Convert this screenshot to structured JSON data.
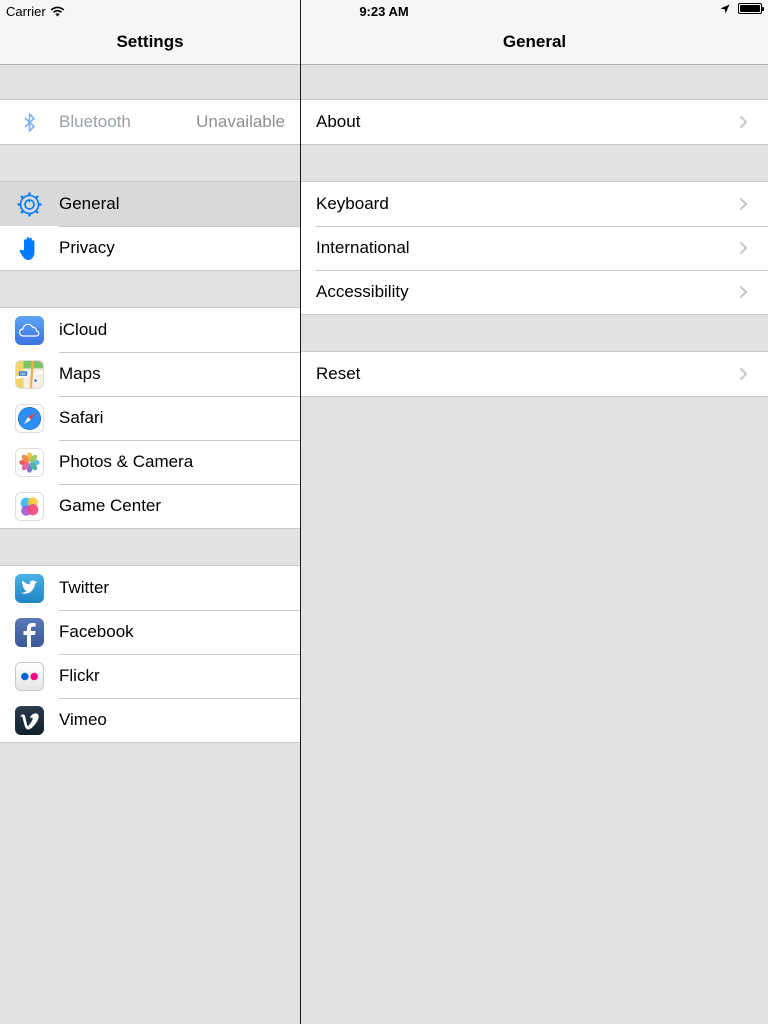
{
  "status_bar": {
    "carrier": "Carrier",
    "time": "9:23 AM"
  },
  "master": {
    "title": "Settings",
    "groups": [
      [
        {
          "icon": "bluetooth-icon",
          "label": "Bluetooth",
          "value": "Unavailable"
        }
      ],
      [
        {
          "icon": "gear-icon",
          "label": "General",
          "selected": true
        },
        {
          "icon": "hand-icon",
          "label": "Privacy"
        }
      ],
      [
        {
          "icon": "icloud-icon",
          "label": "iCloud"
        },
        {
          "icon": "maps-icon",
          "label": "Maps"
        },
        {
          "icon": "safari-compass-icon",
          "label": "Safari"
        },
        {
          "icon": "photos-flower-icon",
          "label": "Photos & Camera"
        },
        {
          "icon": "game-center-icon",
          "label": "Game Center"
        }
      ],
      [
        {
          "icon": "twitter-bird-icon",
          "label": "Twitter"
        },
        {
          "icon": "facebook-icon",
          "label": "Facebook"
        },
        {
          "icon": "flickr-icon",
          "label": "Flickr"
        },
        {
          "icon": "vimeo-icon",
          "label": "Vimeo"
        }
      ]
    ]
  },
  "detail": {
    "title": "General",
    "groups": [
      [
        {
          "label": "About"
        }
      ],
      [
        {
          "label": "Keyboard"
        },
        {
          "label": "International"
        },
        {
          "label": "Accessibility"
        }
      ],
      [
        {
          "label": "Reset"
        }
      ]
    ]
  },
  "colors": {
    "accent": "#007aff",
    "background": "#e2e2e2",
    "cell": "#ffffff",
    "selected_cell": "#d9d9d9",
    "chevron": "#c7c7cc"
  }
}
